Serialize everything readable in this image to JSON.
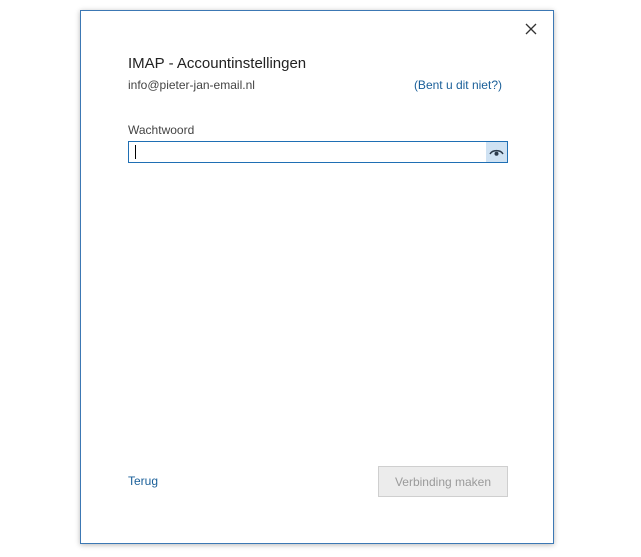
{
  "dialog": {
    "title": "IMAP - Accountinstellingen",
    "email": "info@pieter-jan-email.nl",
    "not_you_link": "(Bent u dit niet?)",
    "close_icon": "close-icon"
  },
  "password": {
    "label": "Wachtwoord",
    "value": "",
    "placeholder": "",
    "reveal_icon": "eye-icon"
  },
  "footer": {
    "back_label": "Terug",
    "connect_label": "Verbinding maken",
    "connect_enabled": false
  },
  "colors": {
    "accent": "#1f6fb4",
    "link": "#1a5f99",
    "border": "#3c78b4",
    "reveal_bg": "#cfe2f3",
    "disabled_bg": "#ececec",
    "disabled_text": "#9a9a9a"
  }
}
